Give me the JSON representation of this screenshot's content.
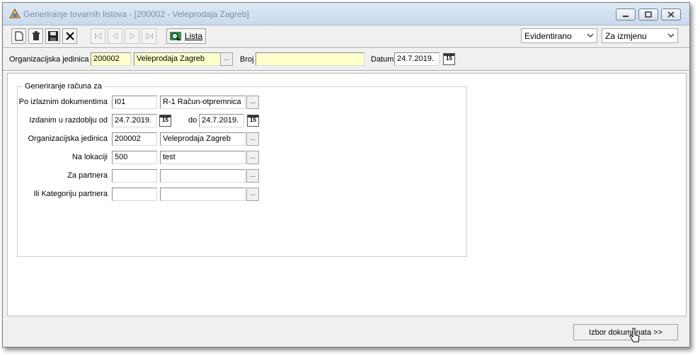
{
  "window": {
    "title": "Generiranje tovarnih listova - [200002 - Veleprodaja Zagreb]"
  },
  "toolbar": {
    "buttons": [
      "new-icon",
      "delete-icon",
      "save-icon",
      "close-icon",
      "first-icon",
      "prev-icon",
      "next-icon",
      "last-icon"
    ],
    "lista_label": "Lista",
    "status_select": "Evidentirano",
    "mode_select": "Za izmjenu"
  },
  "header": {
    "org_unit_label": "Organizacijska jedinica",
    "org_unit_code": "200002",
    "org_unit_name": "Veleprodaja Zagreb",
    "broj_label": "Broj",
    "broj_value": "",
    "datum_label": "Datum",
    "datum_value": "24.7.2019.",
    "calendar_icon_text": "15"
  },
  "group": {
    "title": "Generiranje računa za",
    "rows": [
      {
        "label": "Po izlaznim dokumentima",
        "code": "I01",
        "name": "R-1  Račun-otpremnica"
      },
      {
        "label": "Izdanim u razdoblju od",
        "from": "24.7.2019.",
        "to_label": "do",
        "to": "24.7.2019."
      },
      {
        "label": "Organizacijska jedinica",
        "code": "200002",
        "name": "Veleprodaja Zagreb"
      },
      {
        "label": "Na lokaciji",
        "code": "500",
        "name": "test"
      },
      {
        "label": "Za partnera",
        "code": "",
        "name": ""
      },
      {
        "label": "Ili Kategoriju partnera",
        "code": "",
        "name": ""
      }
    ],
    "dots": "..."
  },
  "footer": {
    "izbor_label": "Izbor dokumenata >>"
  }
}
